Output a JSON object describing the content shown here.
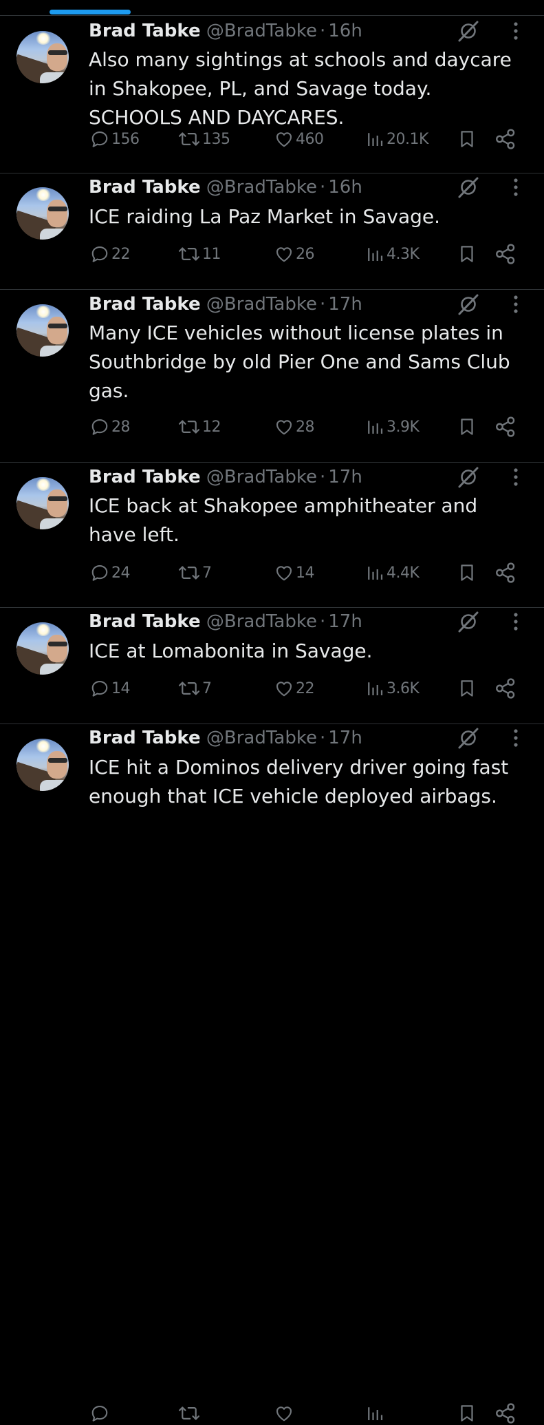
{
  "tweets": [
    {
      "name": "Brad Tabke",
      "handle": "@BradTabke",
      "separator": "·",
      "time": "16h",
      "text": "Also many sightings at schools and daycare\nin Shakopee, PL, and Savage today.\nSCHOOLS AND DAYCARES.",
      "replies": "156",
      "retweets": "135",
      "likes": "460",
      "views": "20.1K"
    },
    {
      "name": "Brad Tabke",
      "handle": "@BradTabke",
      "separator": "·",
      "time": "16h",
      "text": "ICE raiding La Paz Market in Savage.",
      "replies": "22",
      "retweets": "11",
      "likes": "26",
      "views": "4.3K"
    },
    {
      "name": "Brad Tabke",
      "handle": "@BradTabke",
      "separator": "·",
      "time": "17h",
      "text": "Many ICE vehicles without license plates in\nSouthbridge by old Pier One and Sams Club\ngas.",
      "replies": "28",
      "retweets": "12",
      "likes": "28",
      "views": "3.9K"
    },
    {
      "name": "Brad Tabke",
      "handle": "@BradTabke",
      "separator": "·",
      "time": "17h",
      "text": "ICE back at Shakopee amphitheater and\nhave left.",
      "replies": "24",
      "retweets": "7",
      "likes": "14",
      "views": "4.4K"
    },
    {
      "name": "Brad Tabke",
      "handle": "@BradTabke",
      "separator": "·",
      "time": "17h",
      "text": "ICE at Lomabonita in Savage.",
      "replies": "14",
      "retweets": "7",
      "likes": "22",
      "views": "3.6K"
    },
    {
      "name": "Brad Tabke",
      "handle": "@BradTabke",
      "separator": "·",
      "time": "17h",
      "text": "ICE hit a Dominos delivery driver going fast\nenough that ICE vehicle deployed airbags.",
      "replies": "",
      "retweets": "",
      "likes": "",
      "views": ""
    }
  ],
  "icons": {
    "reply": "reply-icon",
    "retweet": "retweet-icon",
    "like": "heart-icon",
    "views": "views-icon",
    "bookmark": "bookmark-icon",
    "share": "share-icon",
    "grok": "grok-icon",
    "more": "more-icon"
  },
  "colors": {
    "background": "#000000",
    "text": "#e7e9ea",
    "muted": "#71767b",
    "divider": "#2f3336",
    "accent": "#1d9bf0"
  }
}
